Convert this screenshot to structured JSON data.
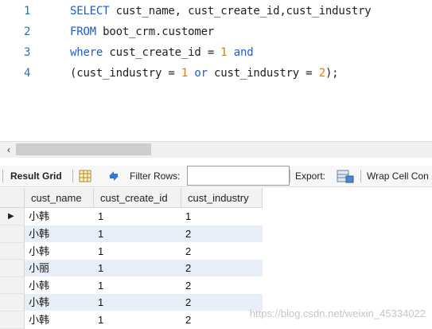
{
  "editor": {
    "lines": [
      {
        "num": "1",
        "tokens": [
          {
            "t": "SELECT",
            "c": "kw"
          },
          {
            "t": " cust_name, cust_create_id,cust_industry",
            "c": ""
          }
        ]
      },
      {
        "num": "2",
        "tokens": [
          {
            "t": "FROM",
            "c": "kw"
          },
          {
            "t": " boot_crm.customer",
            "c": ""
          }
        ]
      },
      {
        "num": "3",
        "tokens": [
          {
            "t": "where",
            "c": "kw"
          },
          {
            "t": " cust_create_id = ",
            "c": ""
          },
          {
            "t": "1",
            "c": "num"
          },
          {
            "t": " ",
            "c": ""
          },
          {
            "t": "and",
            "c": "kw"
          }
        ]
      },
      {
        "num": "4",
        "tokens": [
          {
            "t": "(cust_industry = ",
            "c": ""
          },
          {
            "t": "1",
            "c": "num"
          },
          {
            "t": " ",
            "c": ""
          },
          {
            "t": "or",
            "c": "kw"
          },
          {
            "t": " cust_industry = ",
            "c": ""
          },
          {
            "t": "2",
            "c": "num"
          },
          {
            "t": ");",
            "c": ""
          }
        ]
      }
    ]
  },
  "toolbar": {
    "result_grid_label": "Result Grid",
    "filter_rows_label": "Filter Rows:",
    "filter_value": "",
    "export_label": "Export:",
    "wrap_label": "Wrap Cell Con"
  },
  "grid": {
    "columns": [
      "cust_name",
      "cust_create_id",
      "cust_industry"
    ],
    "rows": [
      [
        "小韩",
        "1",
        "1"
      ],
      [
        "小韩",
        "1",
        "2"
      ],
      [
        "小韩",
        "1",
        "2"
      ],
      [
        "小丽",
        "1",
        "2"
      ],
      [
        "小韩",
        "1",
        "2"
      ],
      [
        "小韩",
        "1",
        "2"
      ],
      [
        "小韩",
        "1",
        "2"
      ]
    ]
  },
  "watermark": "https://blog.csdn.net/weixin_45334022",
  "colors": {
    "keyword": "#1b5cd6",
    "number": "#e07b00",
    "line_number": "#2b6fb6",
    "alt_row": "#e8eef8"
  }
}
